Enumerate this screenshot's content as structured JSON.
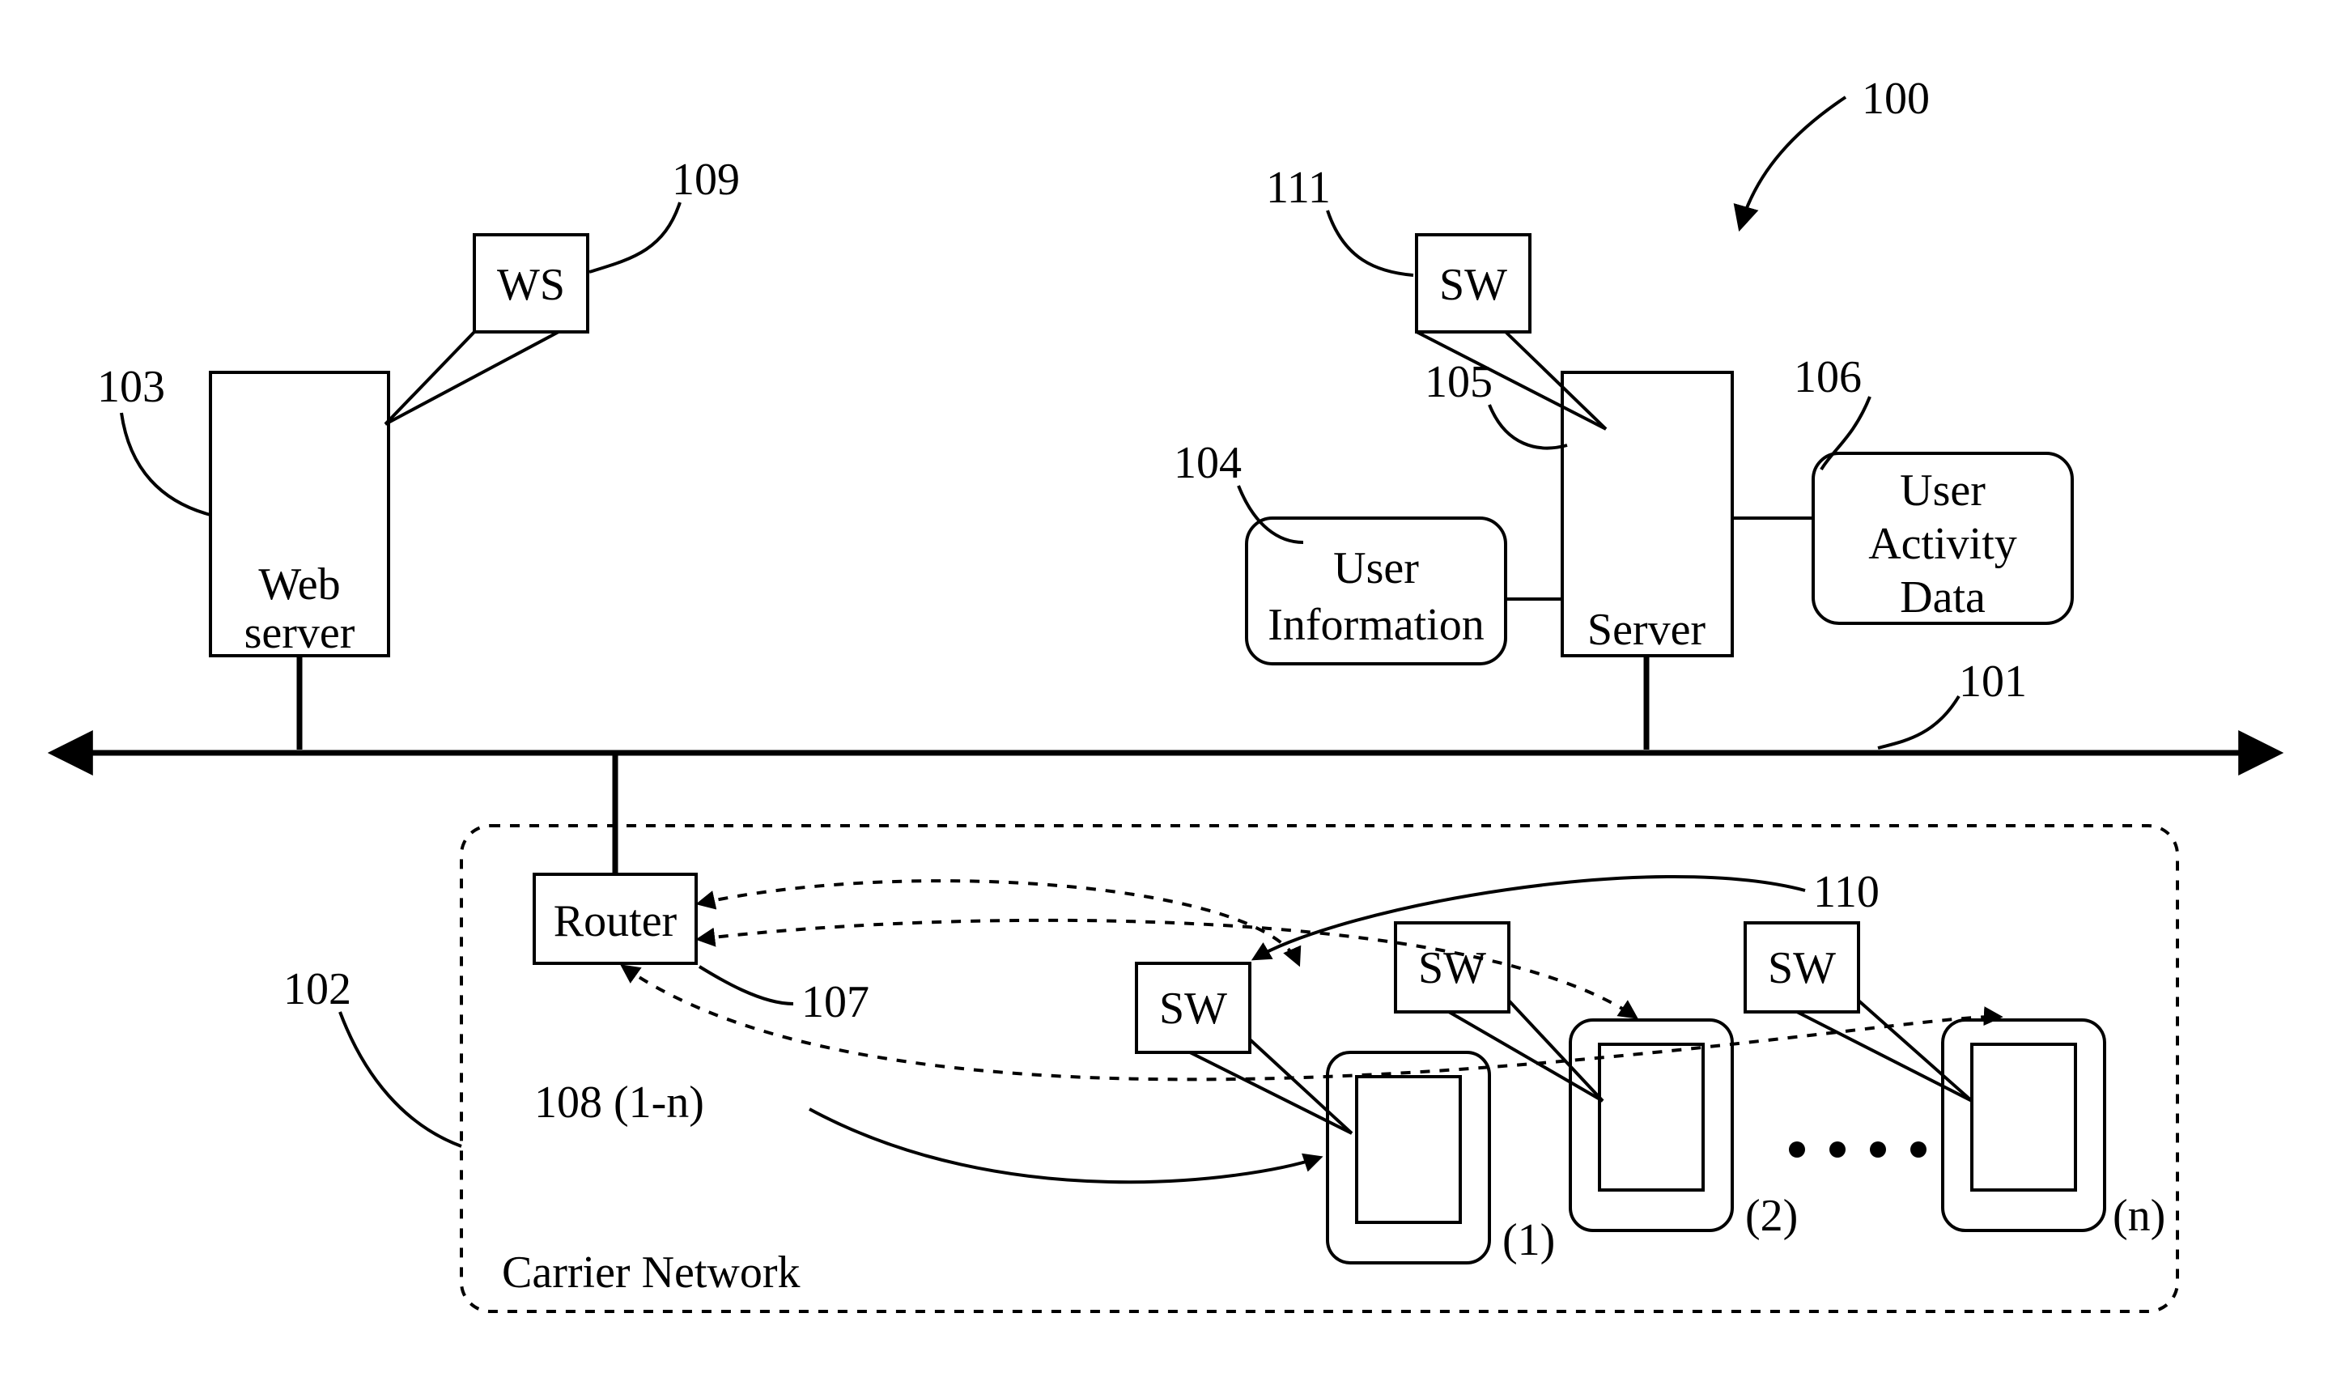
{
  "refs": {
    "r100": "100",
    "r101": "101",
    "r102": "102",
    "r103": "103",
    "r104": "104",
    "r105": "105",
    "r106": "106",
    "r107": "107",
    "r108": "108 (1-n)",
    "r109": "109",
    "r110": "110",
    "r111": "111"
  },
  "blocks": {
    "webserver_line1": "Web",
    "webserver_line2": "server",
    "ws": "WS",
    "sw_server": "SW",
    "server": "Server",
    "user_info_line1": "User",
    "user_info_line2": "Information",
    "user_act_line1": "User",
    "user_act_line2": "Activity",
    "user_act_line3": "Data",
    "router": "Router",
    "carrier": "Carrier Network",
    "sw_dev": "SW",
    "dev1": "(1)",
    "dev2": "(2)",
    "devn": "(n)"
  }
}
